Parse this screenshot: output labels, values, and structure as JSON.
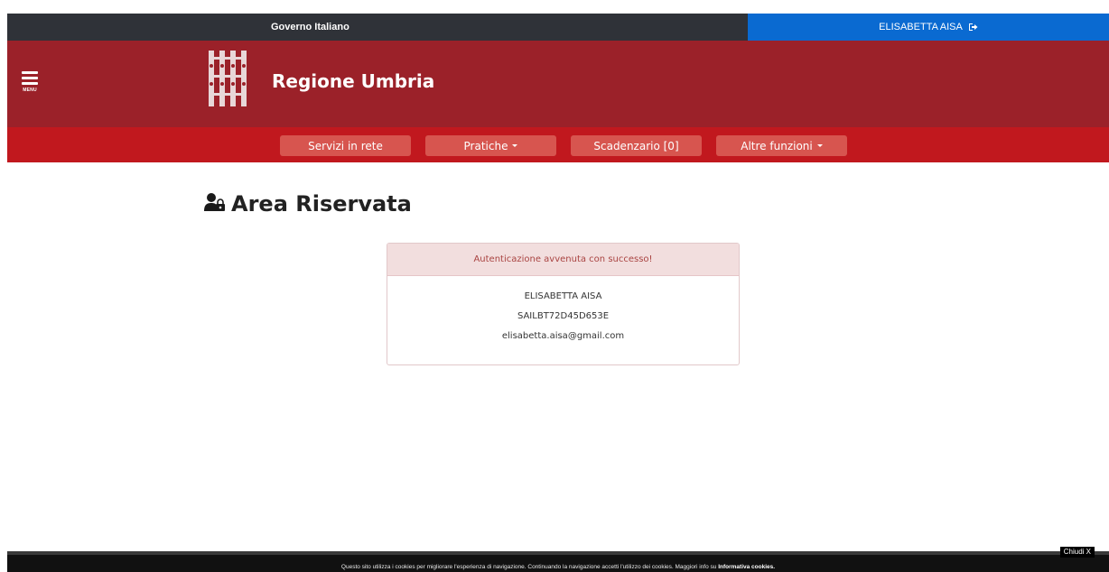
{
  "topbar": {
    "government_label": "Governo Italiano",
    "user_name": "ELISABETTA AISA",
    "logout_icon": "sign-out-icon"
  },
  "header": {
    "menu_label": "MENU",
    "brand_title": "Regione Umbria"
  },
  "nav": {
    "items": [
      {
        "label": "Servizi in rete",
        "dropdown": false
      },
      {
        "label": "Pratiche",
        "dropdown": true
      },
      {
        "label": "Scadenzario [0]",
        "dropdown": false
      },
      {
        "label": "Altre funzioni",
        "dropdown": true
      }
    ]
  },
  "main": {
    "title": "Area Riservata",
    "title_icon": "user-lock-icon",
    "alert": "Autenticazione avvenuta con successo!",
    "user": {
      "name": "ELISABETTA AISA",
      "fiscal_code": "SAILBT72D45D653E",
      "email": "elisabetta.aisa@gmail.com"
    }
  },
  "cookie_bar": {
    "text": "Questo sito utilizza i cookies per migliorare l'esperienza di navigazione. Continuando la navigazione accetti l'utilizzo dei cookies. Maggiori info su ",
    "link": "Informativa cookies",
    "after_link": ".",
    "close_label": "Chiudi X"
  },
  "colors": {
    "gov_bar": "#2f3238",
    "user_bar": "#0a6ad1",
    "header": "#9b2129",
    "nav": "#c1181e",
    "nav_button": "#d7554f",
    "alert_bg": "#f2dede",
    "alert_text": "#a94442"
  }
}
